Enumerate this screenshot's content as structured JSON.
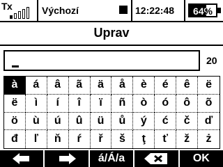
{
  "status": {
    "tx_label": "Tx",
    "model_name": "Výchozí",
    "timer_icon": "stop-square-icon",
    "time": "12:22:48",
    "battery_text": "64%",
    "battery_level": 0.64
  },
  "title": "Uprav",
  "input": {
    "value": "",
    "max_length": "20"
  },
  "keyboard": {
    "rows": [
      [
        "à",
        "á",
        "â",
        "ã",
        "ä",
        "å",
        "è",
        "é",
        "ê",
        "ë"
      ],
      [
        "ë",
        "ì",
        "í",
        "î",
        "ï",
        "ñ",
        "ò",
        "ó",
        "ô",
        "õ"
      ],
      [
        "ö",
        "ù",
        "ú",
        "û",
        "ü",
        "ů",
        "ý",
        "ć",
        "č",
        "ď"
      ],
      [
        "đ",
        "ľ",
        "ň",
        "ŕ",
        "ř",
        "š",
        "ţ",
        "ť",
        "ž",
        "ż"
      ]
    ],
    "selected": "à"
  },
  "bottom_bar": {
    "left_icon": "arrow-left-icon",
    "right_icon": "arrow-right-icon",
    "case_label": "á/Á/a",
    "backspace_icon": "backspace-icon",
    "ok_label": "OK"
  }
}
